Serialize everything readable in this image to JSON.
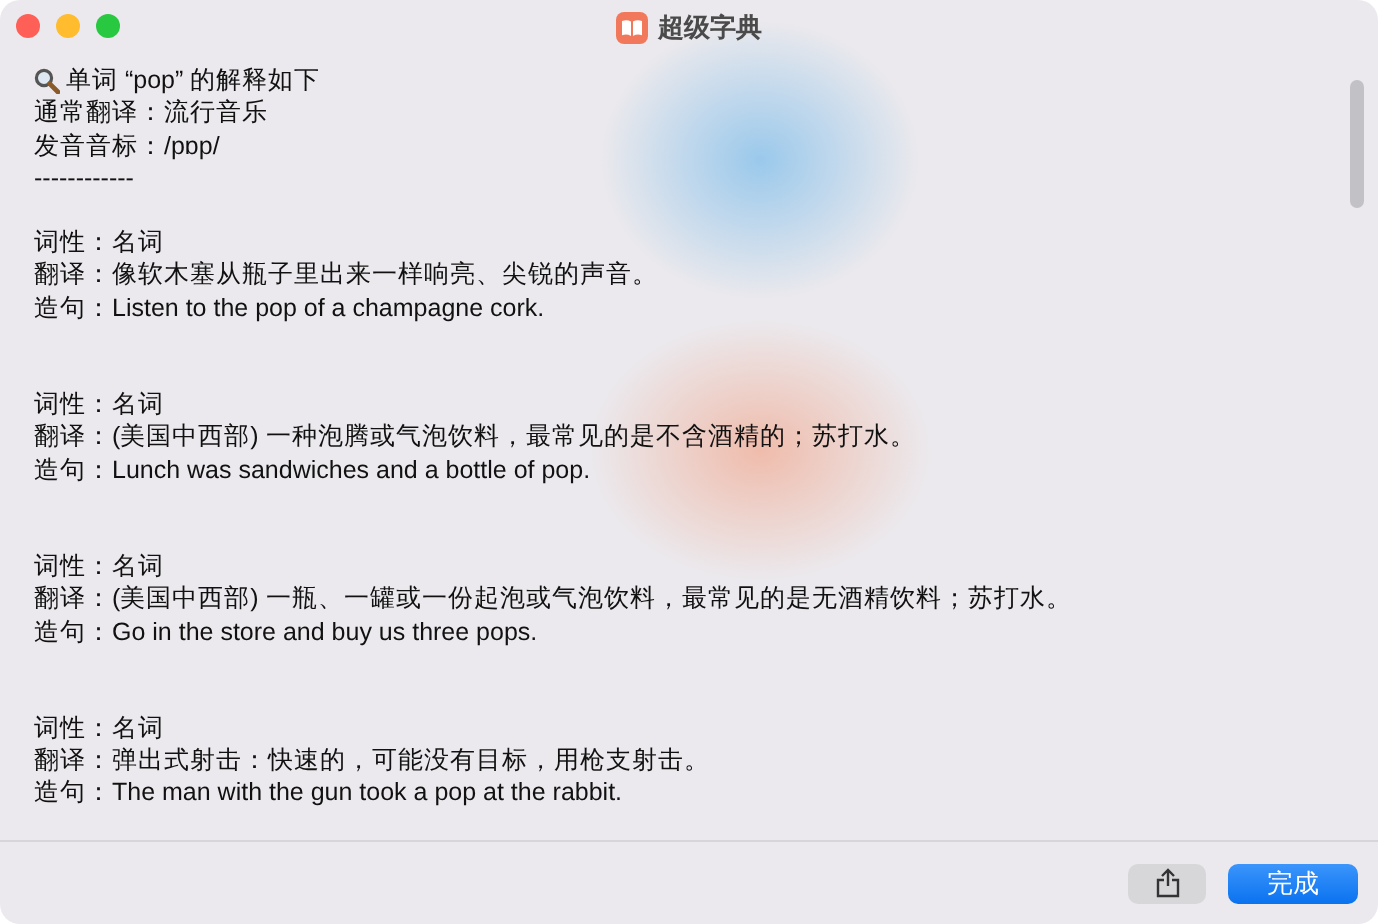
{
  "window": {
    "title": "超级字典"
  },
  "header": {
    "query": "单词 “pop” 的解释如下",
    "lines": [
      "通常翻译：流行音乐",
      "发音音标：/pɒp/",
      "------------"
    ]
  },
  "entries": [
    {
      "lines": [
        "词性：名词",
        "翻译：像软木塞从瓶子里出来一样响亮、尖锐的声音。",
        "造句：Listen to the pop of a champagne cork."
      ]
    },
    {
      "lines": [
        "词性：名词",
        "翻译：(美国中西部) 一种泡腾或气泡饮料，最常见的是不含酒精的；苏打水。",
        "造句：Lunch was sandwiches and a bottle of pop."
      ]
    },
    {
      "lines": [
        "词性：名词",
        "翻译：(美国中西部) 一瓶、一罐或一份起泡或气泡饮料，最常见的是无酒精饮料；苏打水。",
        "造句：Go in the store and buy us three pops."
      ]
    },
    {
      "lines": [
        "词性：名词",
        "翻译：弹出式射击：快速的，可能没有目标，用枪支射击。",
        "造句：The man with the gun took a pop at the rabbit."
      ]
    }
  ],
  "buttons": {
    "done": "完成"
  }
}
